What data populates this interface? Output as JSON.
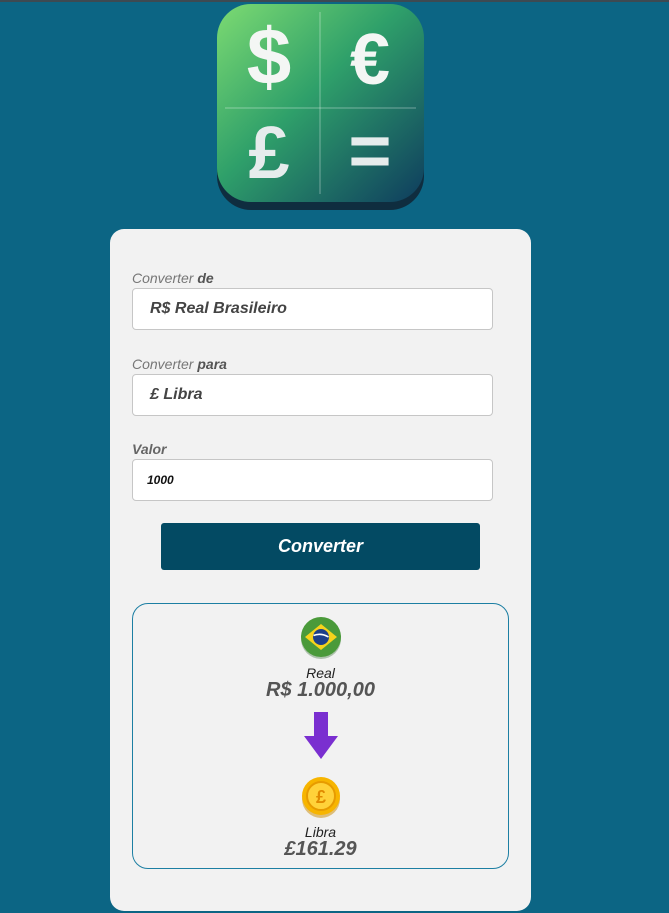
{
  "logo": {
    "symbols": [
      "$",
      "€",
      "£",
      "="
    ]
  },
  "form": {
    "from_label_prefix": "Converter ",
    "from_label_strong": "de",
    "from_value": "R$ Real Brasileiro",
    "to_label_prefix": "Converter ",
    "to_label_strong": "para",
    "to_value": "£ Libra",
    "amount_label": "Valor",
    "amount_value": "1000",
    "convert_button": "Converter"
  },
  "result": {
    "source_icon": "brazil-flag-icon",
    "source_name": "Real",
    "source_amount": "R$ 1.000,00",
    "arrow_icon": "arrow-down-icon",
    "target_icon": "pound-coin-icon",
    "target_name": "Libra",
    "target_amount": "£161.29"
  },
  "colors": {
    "background": "#0c6584",
    "card": "#f2f2f2",
    "button": "#034a63",
    "result_border": "#1d7fa3",
    "arrow": "#7a2fd0"
  }
}
